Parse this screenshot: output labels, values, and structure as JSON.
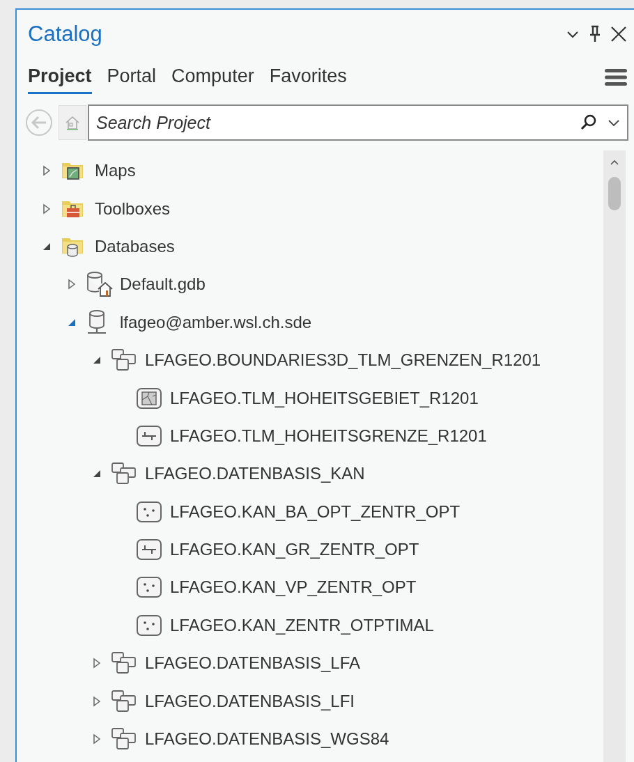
{
  "pane": {
    "title": "Catalog"
  },
  "tabs": [
    {
      "label": "Project",
      "selected": true
    },
    {
      "label": "Portal",
      "selected": false
    },
    {
      "label": "Computer",
      "selected": false
    },
    {
      "label": "Favorites",
      "selected": false
    }
  ],
  "search": {
    "placeholder": "Search Project"
  },
  "tree": [
    {
      "label": "Maps",
      "kind": "maps",
      "expanded": false
    },
    {
      "label": "Toolboxes",
      "kind": "toolboxes",
      "expanded": false
    },
    {
      "label": "Databases",
      "kind": "databases",
      "expanded": true,
      "children": [
        {
          "label": "Default.gdb",
          "kind": "gdb",
          "expanded": false
        },
        {
          "label": "lfageo@amber.wsl.ch.sde",
          "kind": "sde",
          "expanded": true,
          "children": [
            {
              "label": "LFAGEO.BOUNDARIES3D_TLM_GRENZEN_R1201",
              "kind": "dataset",
              "expanded": true,
              "children": [
                {
                  "label": "LFAGEO.TLM_HOHEITSGEBIET_R1201",
                  "kind": "polygon"
                },
                {
                  "label": "LFAGEO.TLM_HOHEITSGRENZE_R1201",
                  "kind": "line"
                }
              ]
            },
            {
              "label": "LFAGEO.DATENBASIS_KAN",
              "kind": "dataset",
              "expanded": true,
              "children": [
                {
                  "label": "LFAGEO.KAN_BA_OPT_ZENTR_OPT",
                  "kind": "point"
                },
                {
                  "label": "LFAGEO.KAN_GR_ZENTR_OPT",
                  "kind": "line"
                },
                {
                  "label": "LFAGEO.KAN_VP_ZENTR_OPT",
                  "kind": "point"
                },
                {
                  "label": "LFAGEO.KAN_ZENTR_OTPTIMAL",
                  "kind": "point"
                }
              ]
            },
            {
              "label": "LFAGEO.DATENBASIS_LFA",
              "kind": "dataset",
              "expanded": false
            },
            {
              "label": "LFAGEO.DATENBASIS_LFI",
              "kind": "dataset",
              "expanded": false
            },
            {
              "label": "LFAGEO.DATENBASIS_WGS84",
              "kind": "dataset",
              "expanded": false
            }
          ]
        }
      ]
    }
  ]
}
